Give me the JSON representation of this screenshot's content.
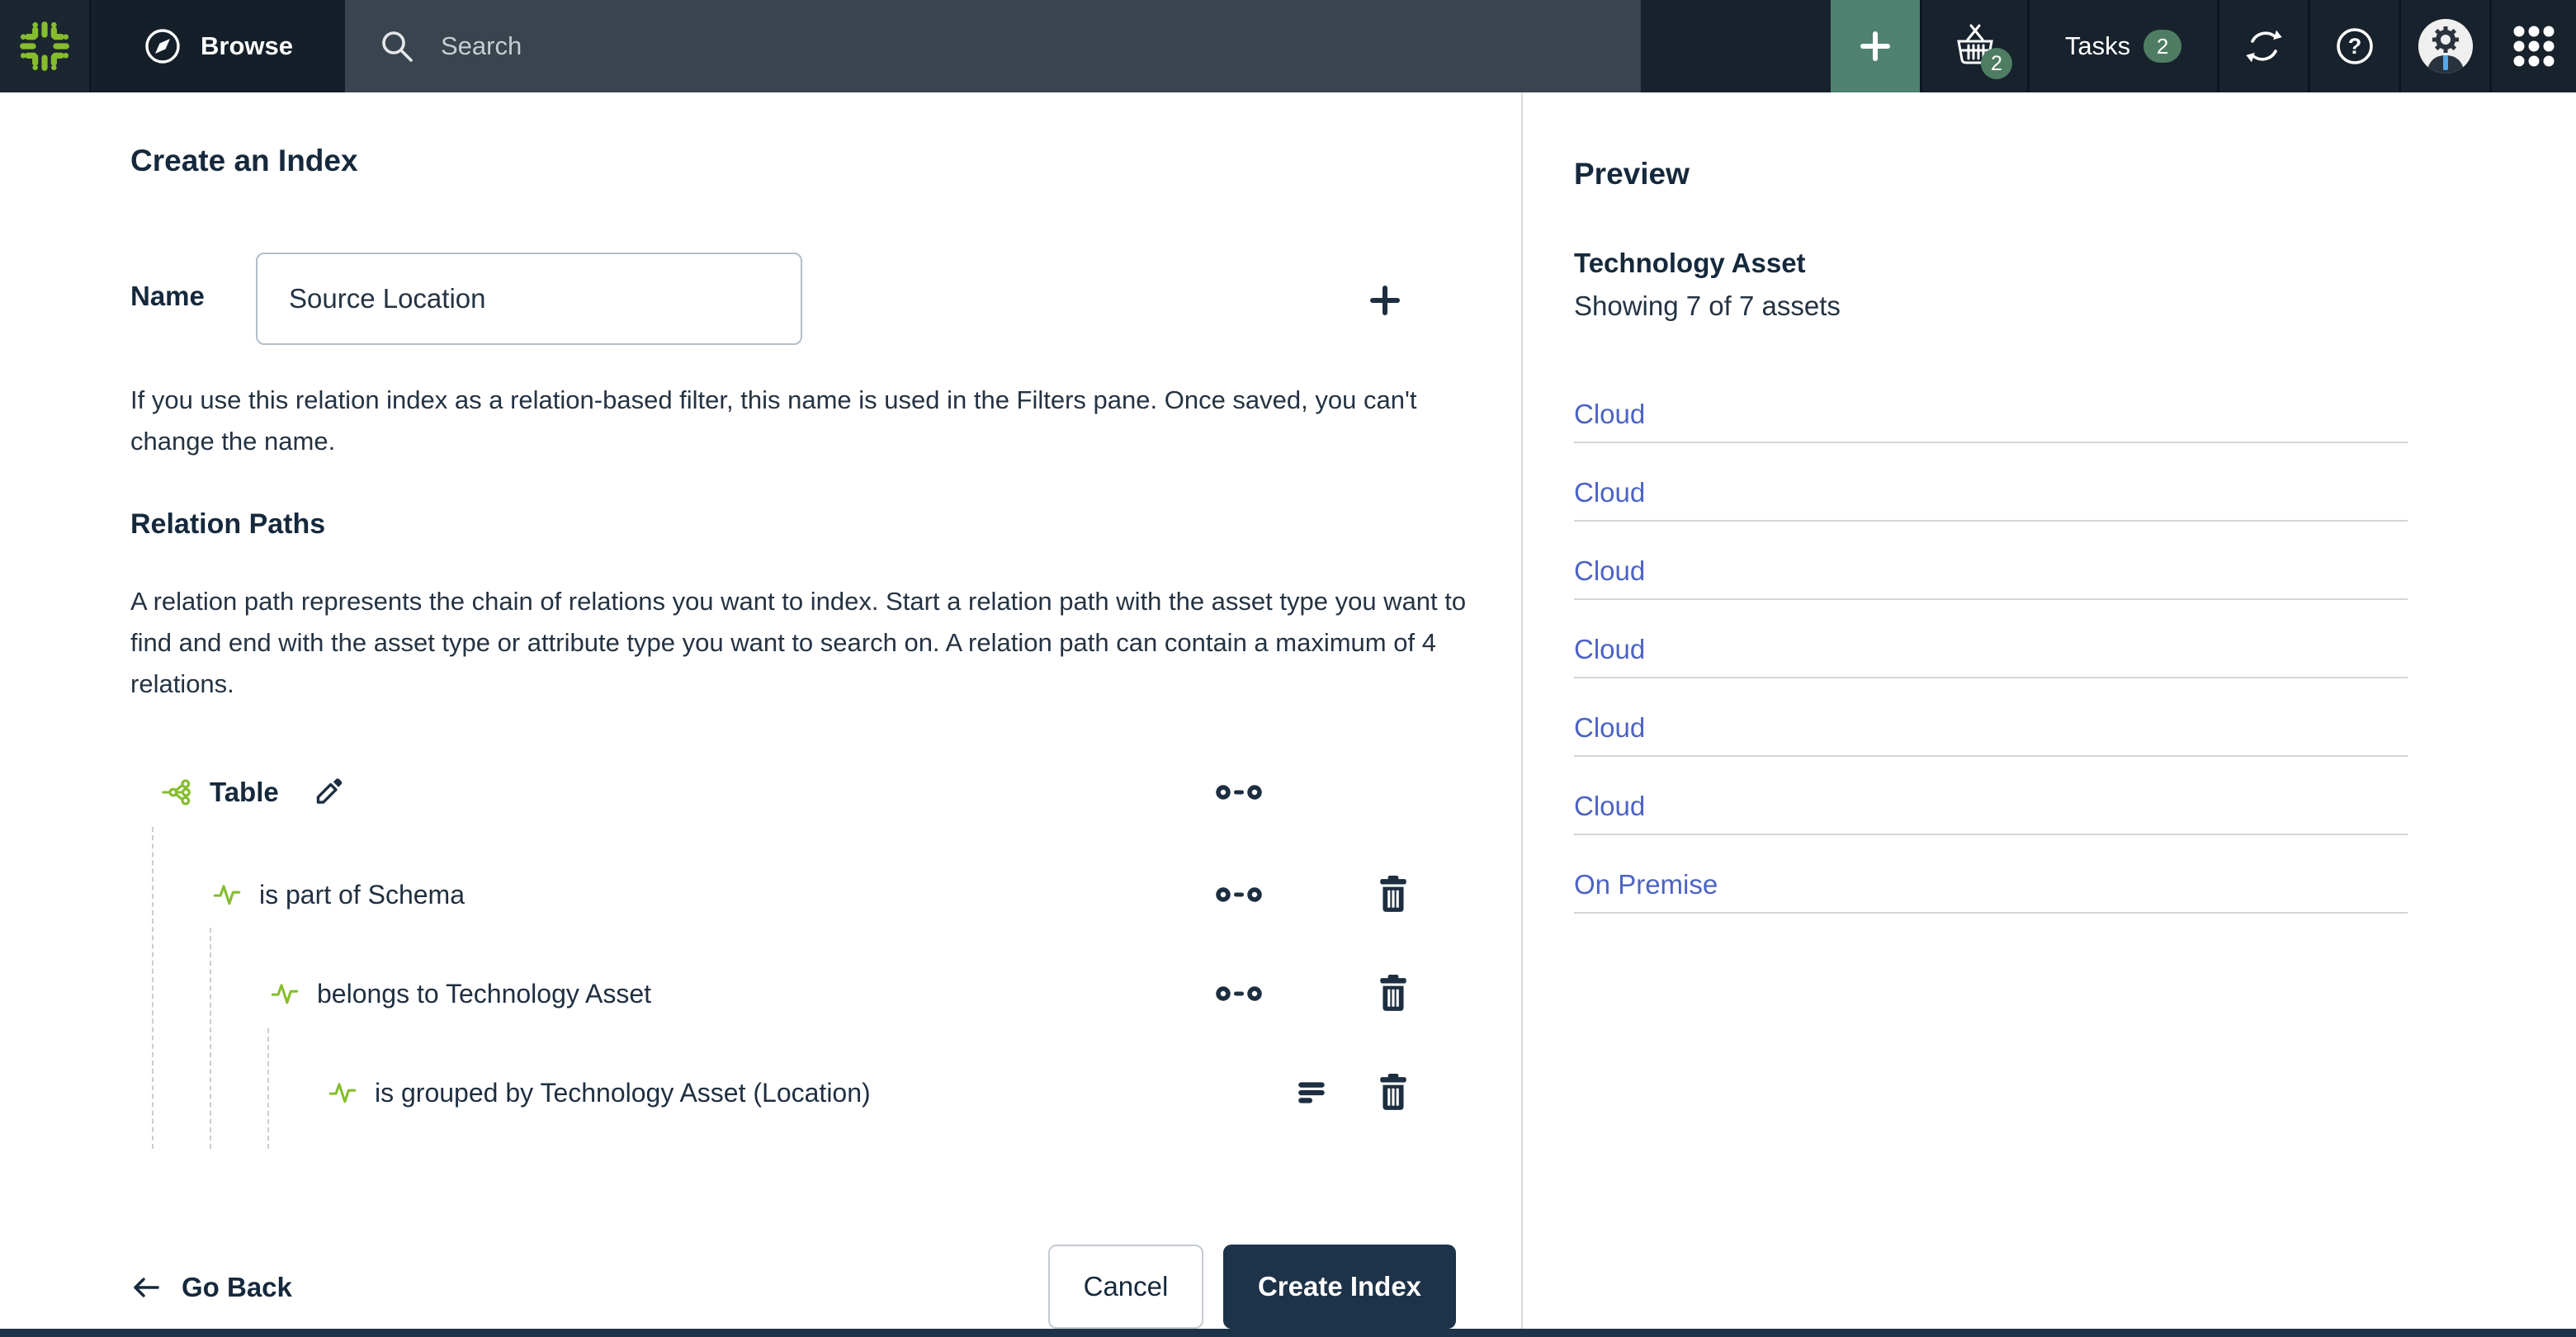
{
  "topbar": {
    "browse_label": "Browse",
    "search_placeholder": "Search",
    "cart_badge": "2",
    "tasks_label": "Tasks",
    "tasks_badge": "2"
  },
  "main": {
    "title": "Create an Index",
    "name_label": "Name",
    "name_value": "Source Location",
    "name_help": "If you use this relation index as a relation-based filter, this name is used in the Filters pane. Once saved, you can't change the name.",
    "relation_paths_title": "Relation Paths",
    "relation_paths_desc": "A relation path represents the chain of relations you want to index. Start a relation path with the asset type you want to find and end with the asset type or attribute type you want to search on. A relation path can contain a maximum of 4 relations.",
    "root_asset": "Table",
    "relations": [
      {
        "label": "is part of Schema"
      },
      {
        "label": "belongs to Technology Asset"
      },
      {
        "label": "is grouped by Technology Asset (Location)"
      }
    ],
    "footer": {
      "go_back": "Go Back",
      "cancel": "Cancel",
      "create": "Create Index"
    }
  },
  "preview": {
    "title": "Preview",
    "asset_type": "Technology Asset",
    "showing": "Showing 7 of 7 assets",
    "items": [
      {
        "label": "Cloud"
      },
      {
        "label": "Cloud"
      },
      {
        "label": "Cloud"
      },
      {
        "label": "Cloud"
      },
      {
        "label": "Cloud"
      },
      {
        "label": "Cloud"
      },
      {
        "label": "On Premise"
      }
    ]
  },
  "icons": {
    "logo": "collibra-logo",
    "compass": "browse-compass",
    "search": "magnifier",
    "plus": "add",
    "basket": "shopping-basket",
    "sync": "refresh-arrows",
    "help": "question-circle",
    "avatar": "admin-user",
    "grid": "app-grid",
    "share_green": "asset-relation-node",
    "pulse_green": "relation-activity",
    "pencil": "edit",
    "oo": "relation-type",
    "bars": "attribute-lines",
    "trash": "delete",
    "arrow_left": "back-arrow"
  },
  "colors": {
    "topbar_navy": "#17222c",
    "accent_green_tile": "#4f8270",
    "badge_green": "#4e7d63",
    "logo_green": "#86bd2d",
    "heading_navy": "#16293c",
    "icon_navy": "#1d2e40",
    "button_navy": "#1d3349",
    "link_blue": "#4c63c5"
  }
}
